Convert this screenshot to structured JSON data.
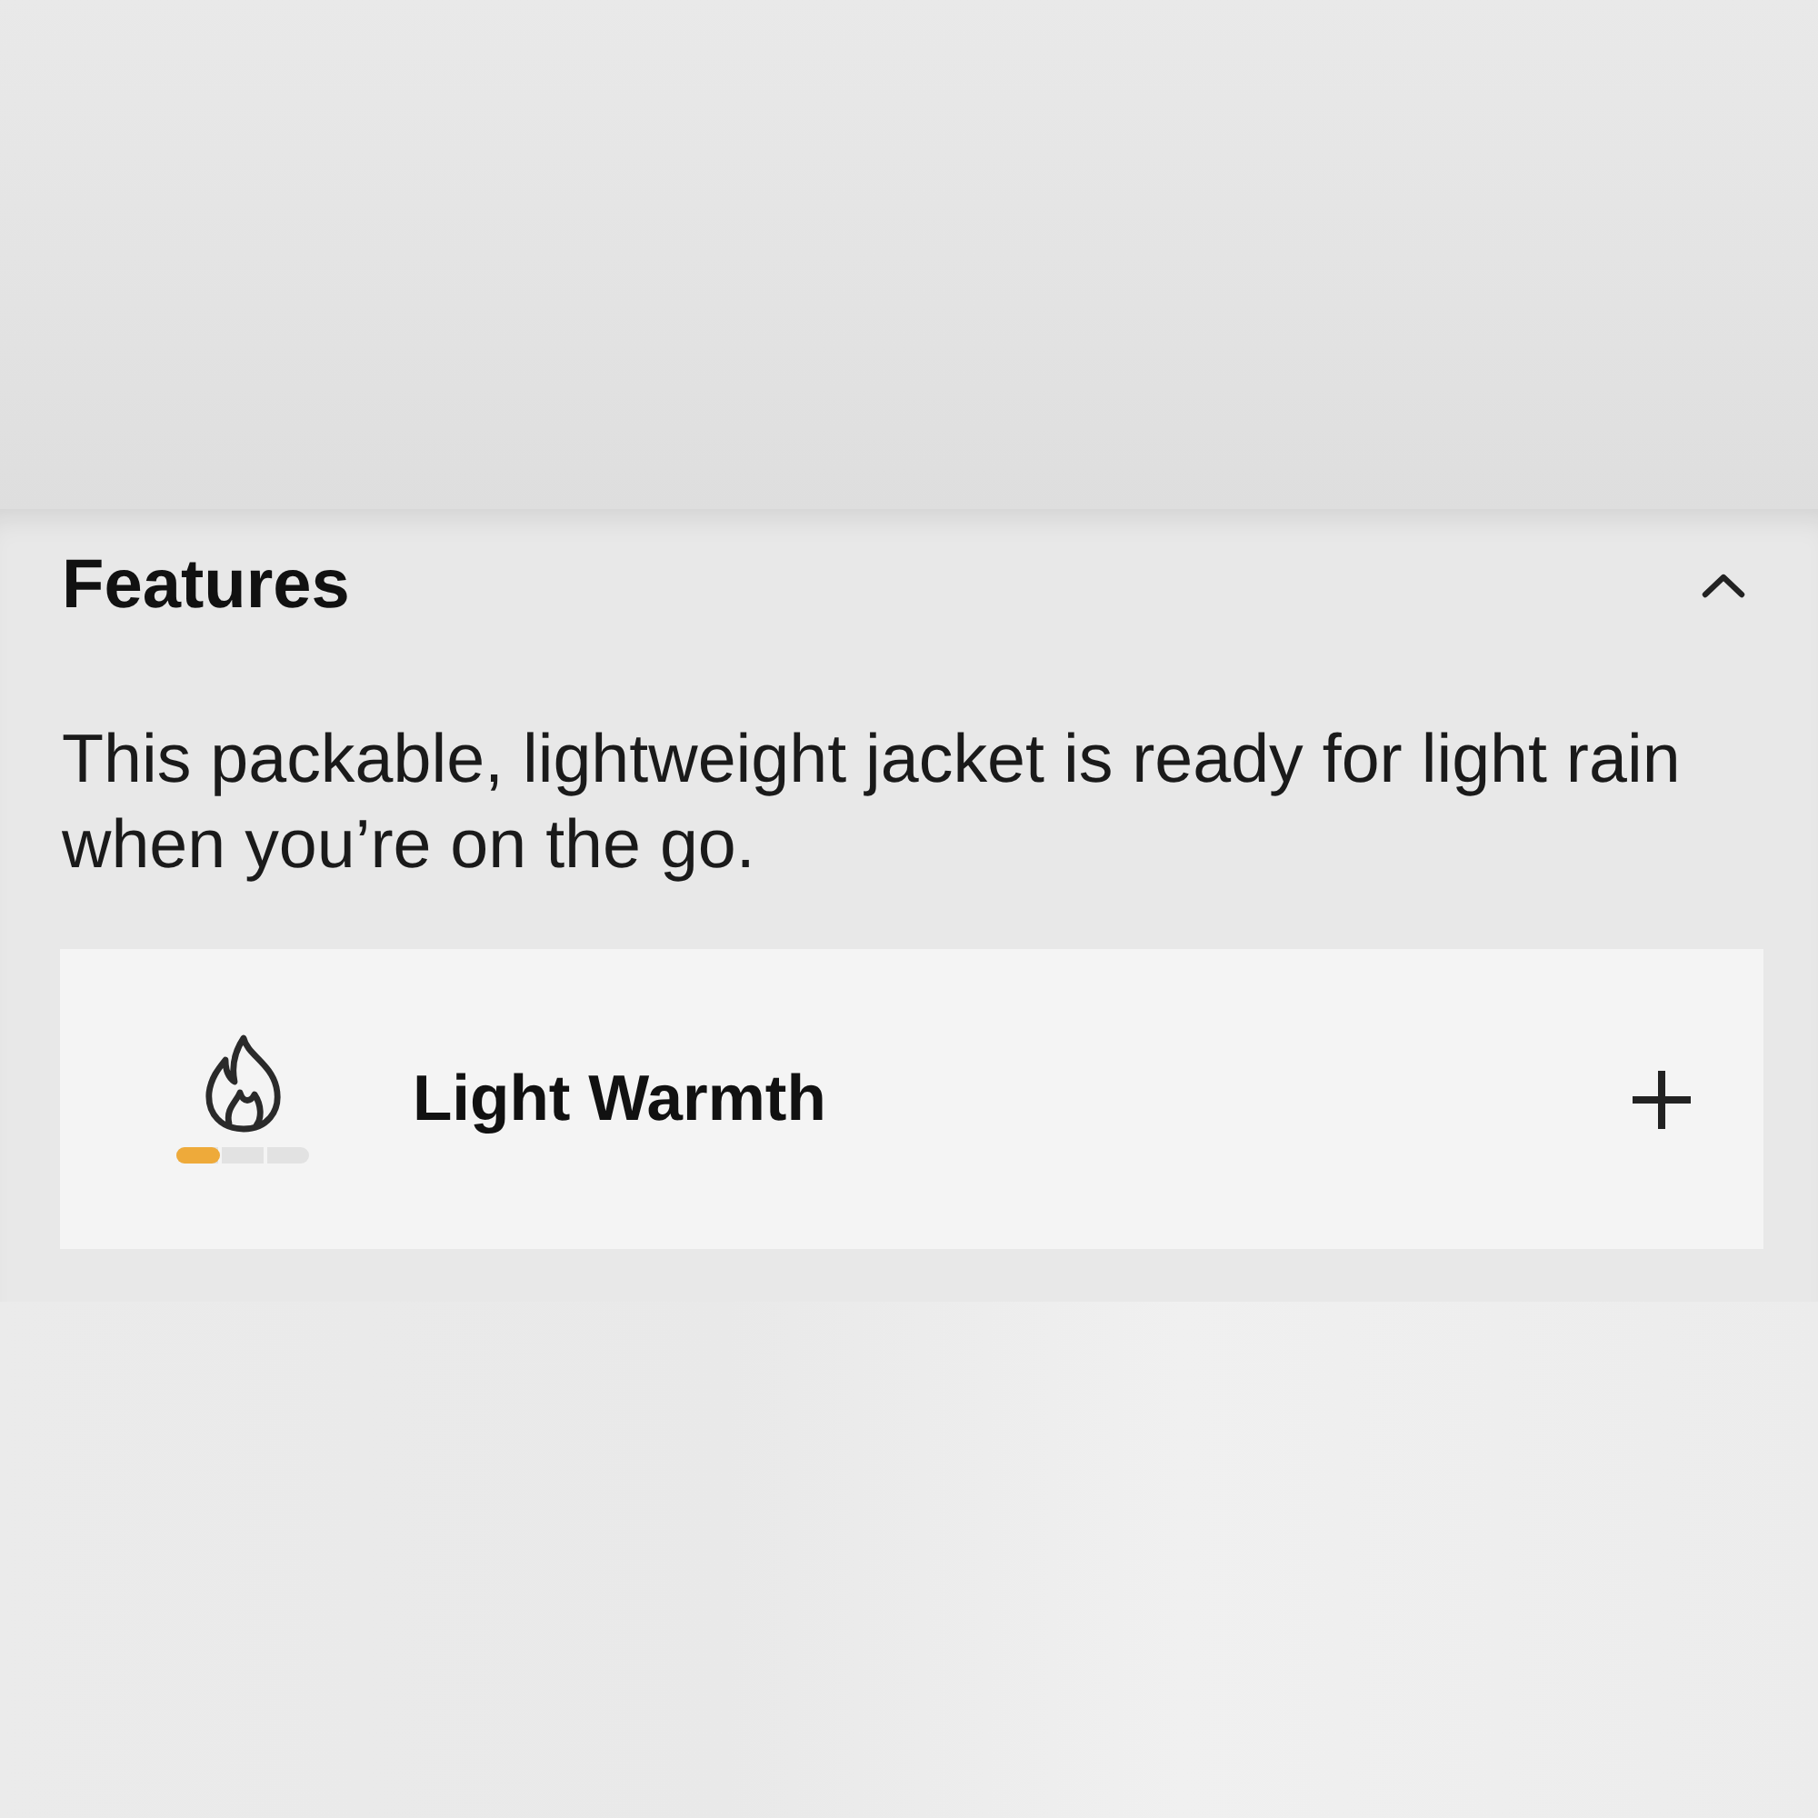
{
  "section": {
    "title": "Features",
    "expanded": true,
    "description": "This packable, lightweight jacket is ready for light rain when you’re on the go.",
    "features": [
      {
        "label": "Light Warmth",
        "level": 0.33,
        "expanded": false
      }
    ]
  }
}
